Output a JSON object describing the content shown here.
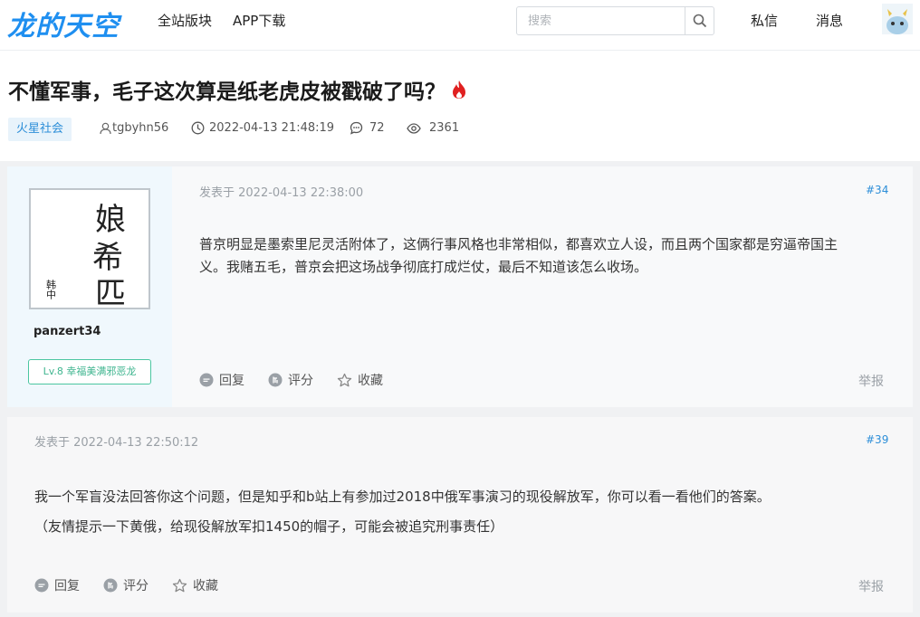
{
  "header": {
    "logo": "龙的天空",
    "nav": [
      "全站版块",
      "APP下载"
    ],
    "search_placeholder": "搜索",
    "messages": "私信",
    "notifications": "消息"
  },
  "thread": {
    "title": "不懂军事，毛子这次算是纸老虎皮被戳破了吗？",
    "tag": "火星社会",
    "author": "tgbyhn56",
    "datetime": "2022-04-13 21:48:19",
    "replies": "72",
    "views": "2361"
  },
  "posts": [
    {
      "username": "panzert34",
      "level": "Lv.8 幸福美满邪恶龙",
      "avatar_text": [
        "娘",
        "希",
        "匹",
        "韩中"
      ],
      "time": "发表于 2022-04-13 22:38:00",
      "floor": "#34",
      "lines": [
        "普京明显是墨索里尼灵活附体了，这俩行事风格也非常相似，都喜欢立人设，而且两个国家都是穷逼帝国主",
        "义。我赌五毛，普京会把这场战争彻底打成烂仗，最后不知道该怎么收场。"
      ],
      "actions": [
        "回复",
        "评分",
        "收藏"
      ],
      "report": "举报"
    },
    {
      "time": "发表于 2022-04-13 22:50:12",
      "floor": "#39",
      "lines": [
        "我一个军盲没法回答你这个问题，但是知乎和b站上有参加过2018中俄军事演习的现役解放军，你可以看一看他们的答案。",
        "（友情提示一下黄俄，给现役解放军扣1450的帽子，可能会被追究刑事责任）"
      ],
      "actions": [
        "回复",
        "评分",
        "收藏"
      ],
      "report": "举报"
    }
  ],
  "colors": {
    "brand": "#1f8ff0",
    "hot": "#e02020",
    "level": "#3fb58f"
  }
}
